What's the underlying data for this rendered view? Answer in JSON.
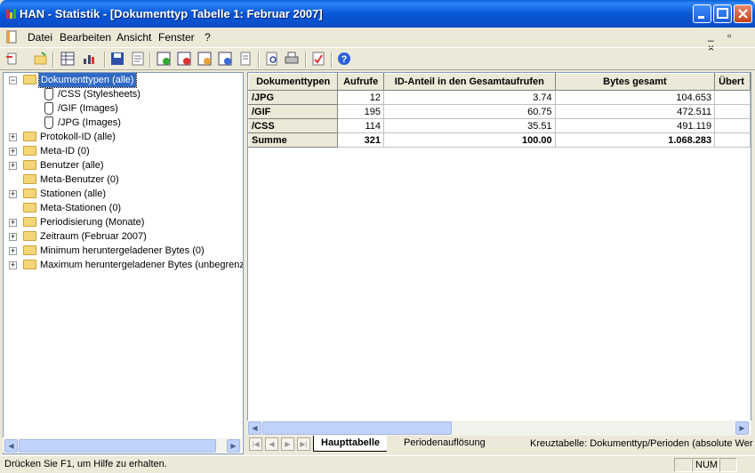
{
  "window": {
    "title": "HAN - Statistik - [Dokumenttyp Tabelle 1: Februar 2007]"
  },
  "menu": {
    "items": [
      "Datei",
      "Bearbeiten",
      "Ansicht",
      "Fenster",
      "?"
    ],
    "mdi_controls": "_ ▫ ×"
  },
  "tree": {
    "nodes": [
      {
        "label": "Dokumenttypen (alle)",
        "expander": "−",
        "selected": true
      },
      {
        "label": "/CSS   (Stylesheets)",
        "leaf": true
      },
      {
        "label": "/GIF   (Images)",
        "leaf": true
      },
      {
        "label": "/JPG   (Images)",
        "leaf": true
      },
      {
        "label": "Protokoll-ID (alle)",
        "expander": "+"
      },
      {
        "label": "Meta-ID (0)",
        "expander": "+"
      },
      {
        "label": "Benutzer (alle)",
        "expander": "+"
      },
      {
        "label": "Meta-Benutzer (0)"
      },
      {
        "label": "Stationen (alle)",
        "expander": "+"
      },
      {
        "label": "Meta-Stationen (0)"
      },
      {
        "label": "Periodisierung (Monate)",
        "expander": "+"
      },
      {
        "label": "Zeitraum (Februar 2007)",
        "expander": "+"
      },
      {
        "label": "Minimum heruntergeladener Bytes (0)",
        "expander": "+"
      },
      {
        "label": "Maximum heruntergeladener Bytes (unbegrenz",
        "expander": "+"
      }
    ]
  },
  "table": {
    "headers": [
      "Dokumenttypen",
      "Aufrufe",
      "ID-Anteil in den Gesamtaufrufen",
      "Bytes gesamt",
      "Übert"
    ],
    "rows": [
      {
        "label": "/JPG",
        "aufrufe": "12",
        "anteil": "3.74",
        "bytes": "104.653"
      },
      {
        "label": "/GIF",
        "aufrufe": "195",
        "anteil": "60.75",
        "bytes": "472.511"
      },
      {
        "label": "/CSS",
        "aufrufe": "114",
        "anteil": "35.51",
        "bytes": "491.119"
      },
      {
        "label": "Summe",
        "aufrufe": "321",
        "anteil": "100.00",
        "bytes": "1.068.283"
      }
    ]
  },
  "tabs": {
    "items": [
      "Haupttabelle",
      "Periodenauflösung"
    ],
    "cross_info": "Kreuztabelle: Dokumenttyp/Perioden (absolute Wer"
  },
  "status": {
    "message": "Drücken Sie F1, um Hilfe zu erhalten.",
    "num": "NUM"
  }
}
